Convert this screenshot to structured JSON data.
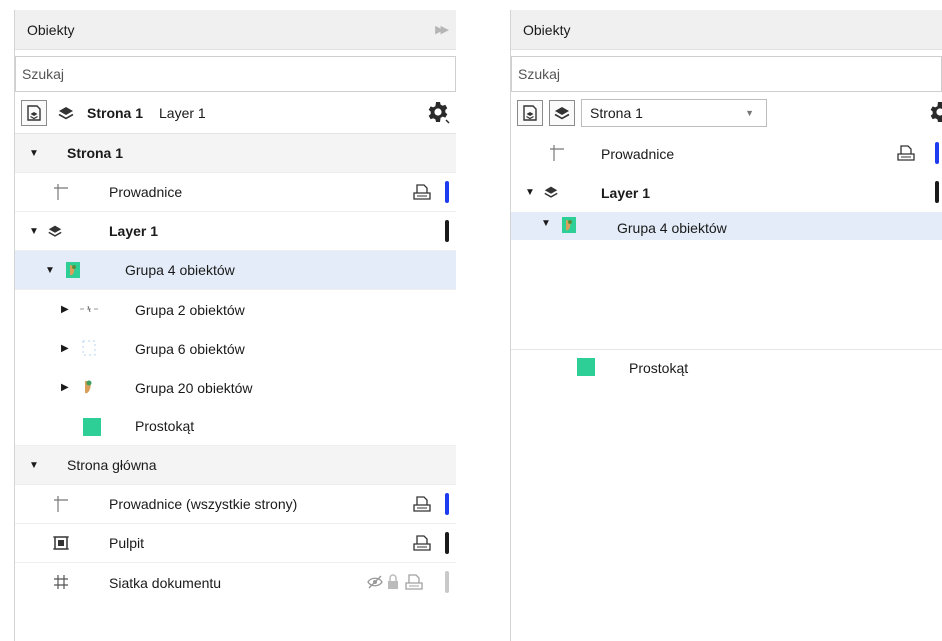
{
  "colors": {
    "accent_blue": "#1f3df0",
    "bar_black": "#1a1a1a",
    "bar_gray": "#c9c9c9",
    "selection": "#e3ecf8",
    "rect_green": "#2ecf97"
  },
  "left": {
    "title": "Obiekty",
    "search_placeholder": "Szukaj",
    "toolbar": {
      "page": "Strona 1",
      "layer": "Layer 1"
    },
    "rows": [
      {
        "label": "Strona 1"
      },
      {
        "label": "Prowadnice"
      },
      {
        "label": "Layer 1"
      },
      {
        "label": "Grupa 4 obiektów"
      },
      {
        "label": "Grupa 2 obiektów"
      },
      {
        "label": "Grupa 6 obiektów"
      },
      {
        "label": "Grupa 20 obiektów"
      },
      {
        "label": "Prostokąt"
      },
      {
        "label": "Strona główna"
      },
      {
        "label": "Prowadnice (wszystkie strony)"
      },
      {
        "label": "Pulpit"
      },
      {
        "label": "Siatka dokumentu"
      }
    ]
  },
  "right": {
    "title": "Obiekty",
    "search_placeholder": "Szukaj",
    "toolbar": {
      "page_select": "Strona 1"
    },
    "rows": [
      {
        "label": "Prowadnice"
      },
      {
        "label": "Layer 1"
      },
      {
        "label": "Grupa 4 obiektów"
      },
      {
        "label": "Prostokąt"
      }
    ]
  }
}
